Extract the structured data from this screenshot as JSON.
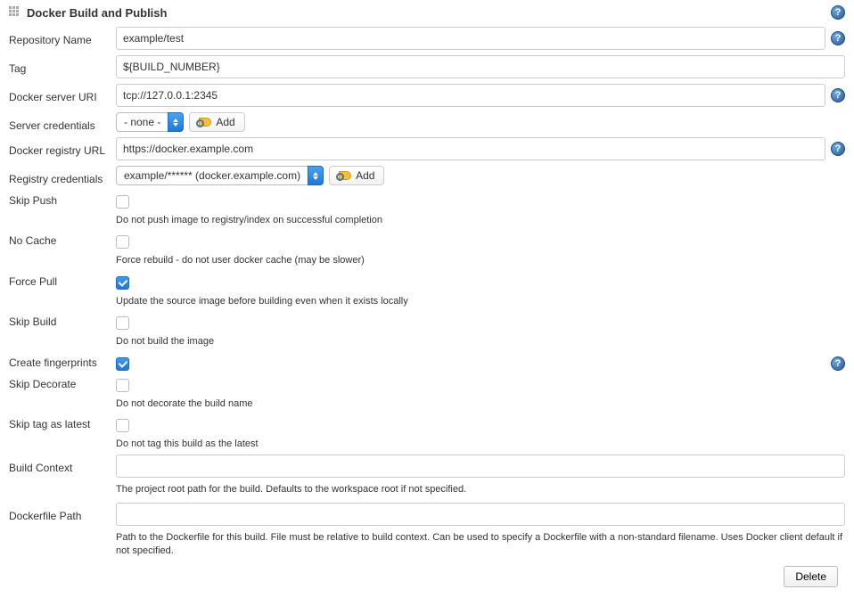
{
  "section": {
    "title": "Docker Build and Publish"
  },
  "labels": {
    "repo_name": "Repository Name",
    "tag": "Tag",
    "server_uri": "Docker server URI",
    "server_creds": "Server credentials",
    "registry_url": "Docker registry URL",
    "registry_creds": "Registry credentials",
    "skip_push": "Skip Push",
    "no_cache": "No Cache",
    "force_pull": "Force Pull",
    "skip_build": "Skip Build",
    "create_fingerprints": "Create fingerprints",
    "skip_decorate": "Skip Decorate",
    "skip_tag_latest": "Skip tag as latest",
    "build_context": "Build Context",
    "dockerfile_path": "Dockerfile Path"
  },
  "values": {
    "repo_name": "example/test",
    "tag": "${BUILD_NUMBER}",
    "server_uri": "tcp://127.0.0.1:2345",
    "server_creds_selected": "- none -",
    "registry_url": "https://docker.example.com",
    "registry_creds_selected": "example/****** (docker.example.com)",
    "build_context": "",
    "dockerfile_path": ""
  },
  "checkboxes": {
    "skip_push": false,
    "no_cache": false,
    "force_pull": true,
    "skip_build": false,
    "create_fingerprints": true,
    "skip_decorate": false,
    "skip_tag_latest": false
  },
  "descriptions": {
    "skip_push": "Do not push image to registry/index on successful completion",
    "no_cache": "Force rebuild - do not user docker cache (may be slower)",
    "force_pull": "Update the source image before building even when it exists locally",
    "skip_build": "Do not build the image",
    "skip_decorate": "Do not decorate the build name",
    "skip_tag_latest": "Do not tag this build as the latest",
    "build_context": "The project root path for the build. Defaults to the workspace root if not specified.",
    "dockerfile_path": "Path to the Dockerfile for this build. File must be relative to build context. Can be used to specify a Dockerfile with a non-standard filename. Uses Docker client default if not specified."
  },
  "buttons": {
    "add": "Add",
    "delete": "Delete"
  },
  "icons": {
    "help": "?"
  }
}
